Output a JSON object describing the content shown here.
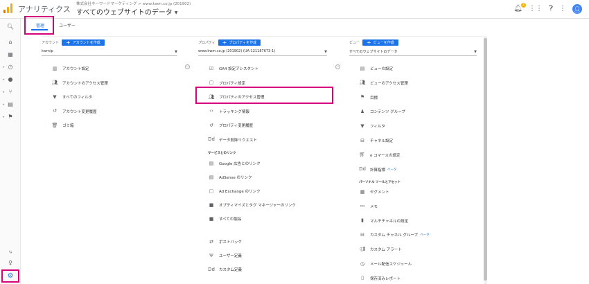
{
  "header": {
    "app_title": "アナリティクス",
    "account_line": "株式会社ネーワードマーケティング > www.kwm.co.jp (201902)",
    "view_title": "すべてのウェブサイトのデータ",
    "notification_count": "2"
  },
  "tabs": {
    "admin": "管理",
    "user": "ユーザー"
  },
  "account": {
    "label": "アカウント",
    "create": "アカウントを作成",
    "selected": "kwm/p",
    "items": [
      {
        "label": "アカウント設定",
        "icon": "building-icon"
      },
      {
        "label": "アカウントのアクセス管理",
        "icon": "people-icon"
      },
      {
        "label": "すべてのフィルタ",
        "icon": "filter-icon"
      },
      {
        "label": "アカウント変更履歴",
        "icon": "history-icon"
      },
      {
        "label": "ゴミ箱",
        "icon": "trash-icon"
      }
    ]
  },
  "property": {
    "label": "プロパティ",
    "create": "プロパティを作成",
    "selected": "www.kwm.co.jp (201902)  (UA-121187673-1)",
    "items": [
      {
        "label": "GA4 設定アシスタント",
        "icon": "checkbox-icon"
      },
      {
        "label": "プロパティ設定",
        "icon": "square-icon"
      },
      {
        "label": "プロパティのアクセス管理",
        "icon": "people-icon"
      },
      {
        "label": "トラッキング情報",
        "icon": "code-icon"
      },
      {
        "label": "プロパティ変更履歴",
        "icon": "history-icon"
      },
      {
        "label": "データ削除リクエスト",
        "icon": "dd-icon"
      }
    ],
    "section_title": "サービスとのリンク",
    "links": [
      {
        "label": "Google 広告とのリンク",
        "icon": "grid-icon"
      },
      {
        "label": "AdSense のリンク",
        "icon": "grid-icon"
      },
      {
        "label": "Ad Exchange のリンク",
        "icon": "square-icon"
      },
      {
        "label": "オプティマイズとタグ マネージャーのリンク",
        "icon": "dark-square-icon"
      },
      {
        "label": "すべての製品",
        "icon": "dark-square-icon"
      }
    ],
    "more": [
      {
        "label": "ポストバック",
        "icon": "postback-icon"
      },
      {
        "label": "ユーザー定義",
        "icon": "fork-icon"
      },
      {
        "label": "カスタム定義",
        "icon": "dd-icon"
      }
    ]
  },
  "view": {
    "label": "ビュー",
    "create": "ビューを作成",
    "selected": "すべてのウェブサイトのデータ",
    "items": [
      {
        "label": "ビューの設定",
        "icon": "doc-icon",
        "beta": ""
      },
      {
        "label": "ビューのアクセス管理",
        "icon": "people-icon",
        "beta": ""
      },
      {
        "label": "目標",
        "icon": "flag-icon",
        "beta": ""
      },
      {
        "label": "コンテンツ グループ",
        "icon": "person-icon",
        "beta": ""
      },
      {
        "label": "フィルタ",
        "icon": "filter-icon",
        "beta": ""
      },
      {
        "label": "チャネル設定",
        "icon": "channel-icon",
        "beta": ""
      },
      {
        "label": "e コマースの設定",
        "icon": "cart-icon",
        "beta": ""
      },
      {
        "label": "計算指標",
        "icon": "dd-icon",
        "beta": "ベータ"
      }
    ],
    "section_title": "パーソナル ツールとアセット",
    "tools": [
      {
        "label": "セグメント",
        "icon": "segment-icon",
        "beta": ""
      },
      {
        "label": "メモ",
        "icon": "note-icon",
        "beta": ""
      },
      {
        "label": "マルチチャネルの設定",
        "icon": "bars-icon",
        "beta": ""
      },
      {
        "label": "カスタム チャネル グループ",
        "icon": "channel-icon",
        "beta": "ベータ"
      },
      {
        "label": "カスタム アラート",
        "icon": "megaphone-icon",
        "beta": ""
      },
      {
        "label": "メール配信スケジュール",
        "icon": "clock-icon",
        "beta": ""
      },
      {
        "label": "保存済みレポート",
        "icon": "saved-icon",
        "beta": ""
      }
    ]
  }
}
